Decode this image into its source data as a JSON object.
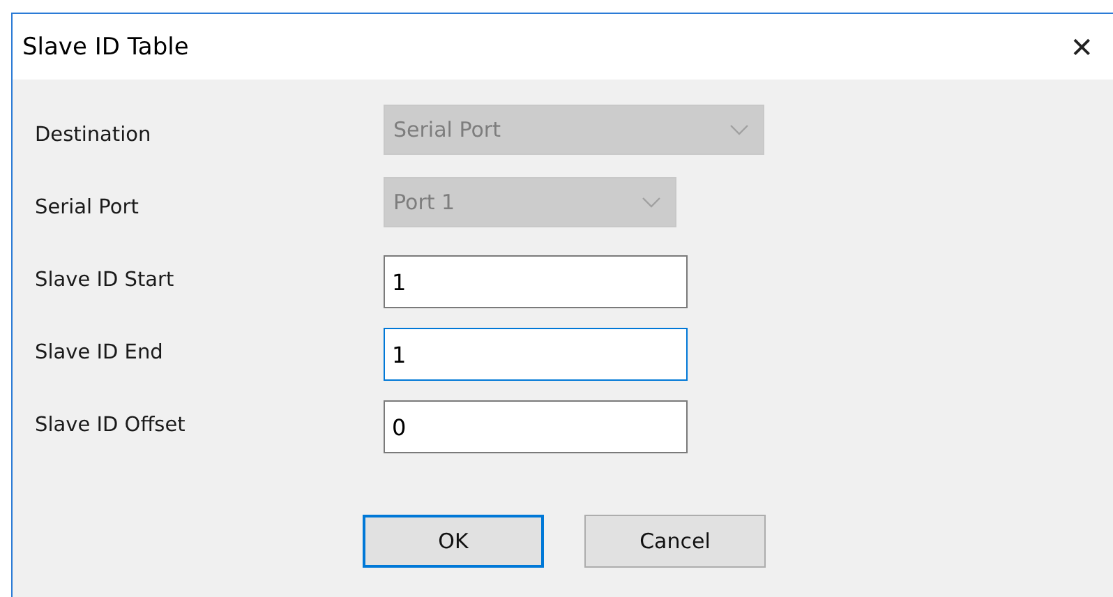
{
  "window": {
    "title": "Slave ID Table",
    "close": "✕"
  },
  "fields": [
    {
      "label": "Destination",
      "kind": "dropdown",
      "value": "Serial Port",
      "disabled": true,
      "wide": true
    },
    {
      "label": "Serial Port",
      "kind": "dropdown",
      "value": "Port 1",
      "disabled": true,
      "wide": false
    },
    {
      "label": "Slave ID Start",
      "kind": "input",
      "value": "1",
      "focused": false
    },
    {
      "label": "Slave ID End",
      "kind": "input",
      "value": "1",
      "focused": true
    },
    {
      "label": "Slave ID Offset",
      "kind": "input",
      "value": "0",
      "focused": false
    }
  ],
  "buttons": [
    {
      "label": "OK",
      "default": true
    },
    {
      "label": "Cancel",
      "default": false
    }
  ]
}
